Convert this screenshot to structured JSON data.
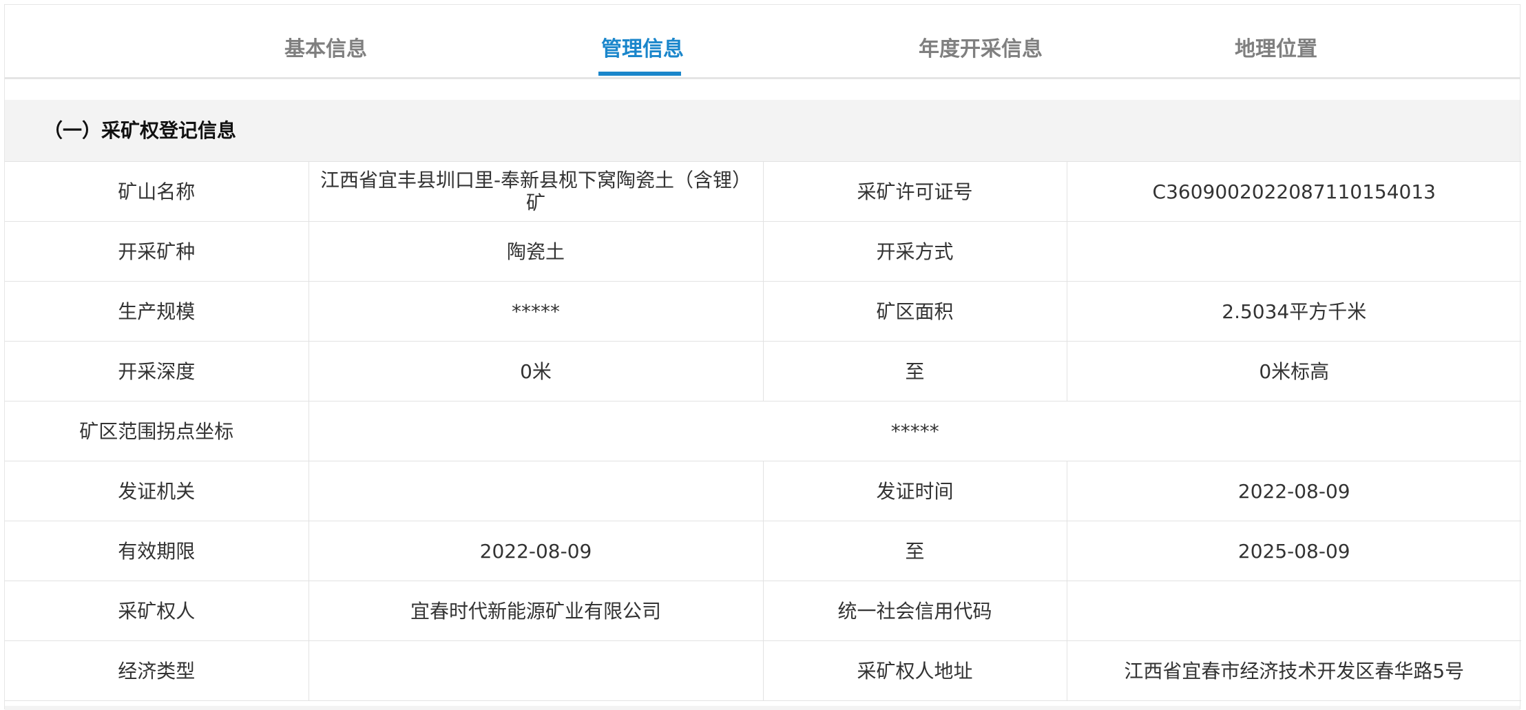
{
  "tabs": [
    {
      "label": "基本信息",
      "active": false
    },
    {
      "label": "管理信息",
      "active": true
    },
    {
      "label": "年度开采信息",
      "active": false
    },
    {
      "label": "地理位置",
      "active": false
    }
  ],
  "colors": {
    "accent": "#1a86cb",
    "inactive_tab": "#7f7f7f",
    "section_bg": "#f3f3f3"
  },
  "section": {
    "title": "（一）采矿权登记信息"
  },
  "table": {
    "mine_name_label": "矿山名称",
    "mine_name_value": "江西省宜丰县圳口里-奉新县枧下窝陶瓷土（含锂）矿",
    "license_no_label": "采矿许可证号",
    "license_no_value": "C3609002022087110154013",
    "mineral_label": "开采矿种",
    "mineral_value": "陶瓷土",
    "method_label": "开采方式",
    "method_value": "",
    "scale_label": "生产规模",
    "scale_value": "*****",
    "area_label": "矿区面积",
    "area_value": "2.5034平方千米",
    "depth_label": "开采深度",
    "depth_from_value": "0米",
    "depth_to_label": "至",
    "depth_to_value": "0米标高",
    "coords_label": "矿区范围拐点坐标",
    "coords_value": "*****",
    "issuer_label": "发证机关",
    "issuer_value": "",
    "issue_date_label": "发证时间",
    "issue_date_value": "2022-08-09",
    "validity_label": "有效期限",
    "validity_from_value": "2022-08-09",
    "validity_to_label": "至",
    "validity_to_value": "2025-08-09",
    "holder_label": "采矿权人",
    "holder_value": "宜春时代新能源矿业有限公司",
    "credit_code_label": "统一社会信用代码",
    "credit_code_value": "",
    "econ_type_label": "经济类型",
    "econ_type_value": "",
    "holder_address_label": "采矿权人地址",
    "holder_address_value": "江西省宜春市经济技术开发区春华路5号"
  }
}
